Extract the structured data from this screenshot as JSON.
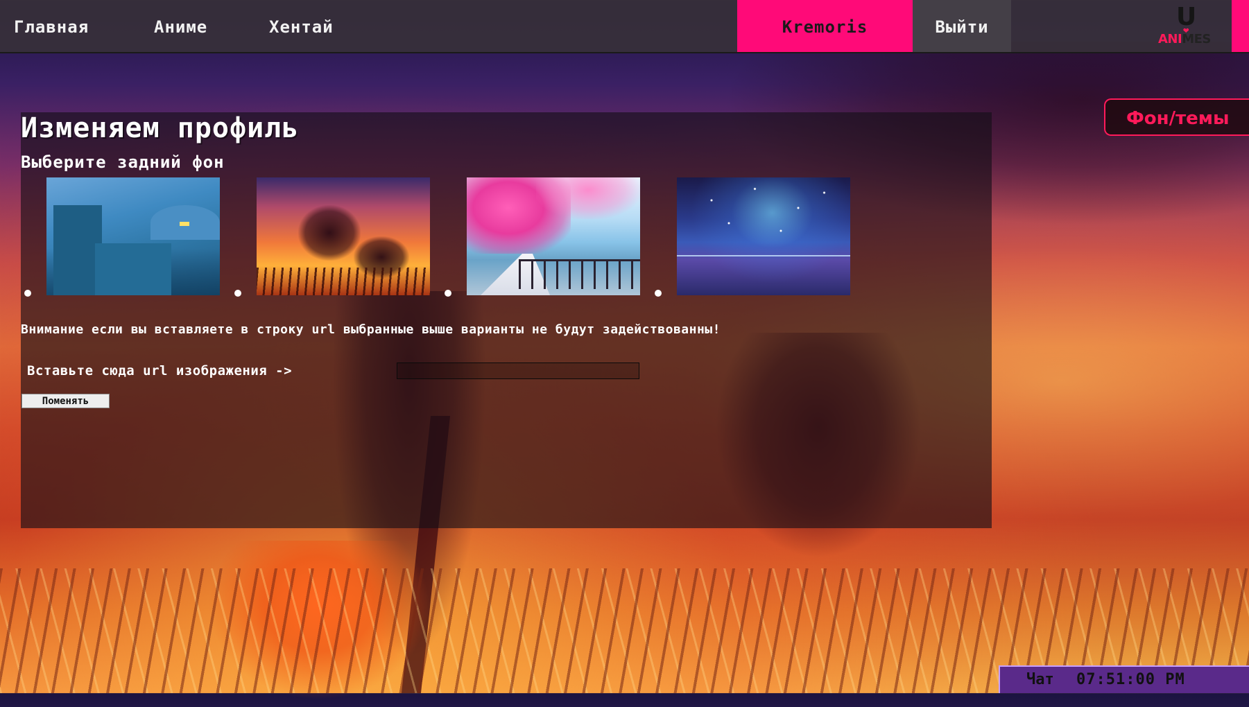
{
  "nav": {
    "home": "Главная",
    "anime": "Аниме",
    "hentai": "Хентай",
    "user": "Kremoris",
    "logout": "Выйти"
  },
  "logo": {
    "letter": "U",
    "ani": "ANI",
    "mes": "MES"
  },
  "side_tab": {
    "label": "Фон/темы"
  },
  "profile": {
    "title": "Изменяем профиль",
    "subtitle": "Выберите задний фон",
    "backgrounds": [
      {
        "icon": "ruins-landscape-image"
      },
      {
        "icon": "sunset-trees-image"
      },
      {
        "icon": "sakura-path-image"
      },
      {
        "icon": "galaxy-lake-image"
      }
    ],
    "warning": "Внимание если вы вставляете в строку url выбранные выше варианты не будут задействованны!",
    "url_label": "Вставьте сюда url изображения ->",
    "url_value": "",
    "change_button": "Поменять"
  },
  "chat": {
    "label": "Чат",
    "time": "07:51:00 PM"
  },
  "colors": {
    "accent_pink": "#ff0a78",
    "chat_purple": "#5a2a8a"
  }
}
